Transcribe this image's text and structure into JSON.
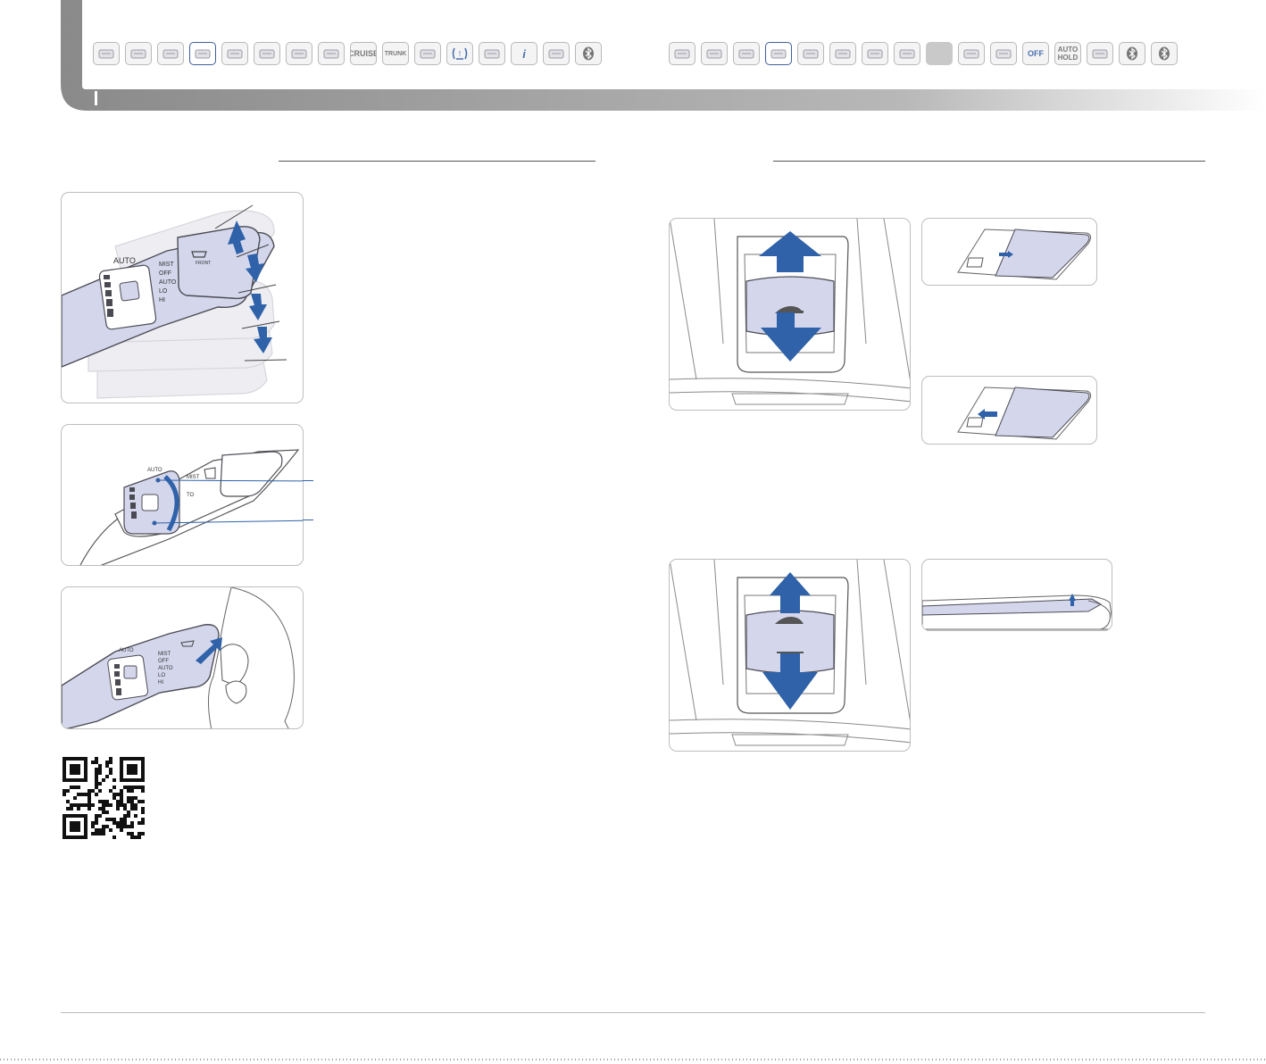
{
  "nav_left": [
    {
      "icon": "wiper-blade-icon"
    },
    {
      "icon": "steering-wheel-icon"
    },
    {
      "icon": "stalk-lever-icon"
    },
    {
      "icon": "wiper-stalk-icon",
      "active": true
    },
    {
      "icon": "seat-icon"
    },
    {
      "icon": "panel-icon"
    },
    {
      "icon": "switch-panel-icon"
    },
    {
      "icon": "mirror-icon"
    },
    {
      "icon": "cruise-icon",
      "label": "CRUISE"
    },
    {
      "icon": "trunk-icon",
      "label": "TRUNK"
    },
    {
      "icon": "key-fob-icon"
    },
    {
      "icon": "tpms-warning-icon"
    },
    {
      "icon": "display-icon"
    },
    {
      "icon": "info-display-icon",
      "label": "i"
    },
    {
      "icon": "climate-panel-icon"
    },
    {
      "icon": "bluetooth-icon"
    }
  ],
  "nav_right": [
    {
      "icon": "voice-icon"
    },
    {
      "icon": "gauge-icon"
    },
    {
      "icon": "key-icon"
    },
    {
      "icon": "sunroof-icon",
      "active": true
    },
    {
      "icon": "console-icon"
    },
    {
      "icon": "switch-bank-icon"
    },
    {
      "icon": "button-cluster-icon"
    },
    {
      "icon": "grid-icon"
    },
    {
      "icon": "blank-icon",
      "dim": true
    },
    {
      "icon": "screen-icon"
    },
    {
      "icon": "gear-shift-icon"
    },
    {
      "icon": "traction-off-icon",
      "label": "OFF"
    },
    {
      "icon": "auto-hold-icon",
      "label_top": "AUTO",
      "label_bottom": "HOLD"
    },
    {
      "icon": "parking-icon"
    },
    {
      "icon": "bluetooth-icon"
    },
    {
      "icon": "bluetooth-icon"
    }
  ],
  "stalk": {
    "labels": [
      "AUTO",
      "MIST",
      "OFF",
      "AUTO",
      "LO",
      "HI"
    ],
    "front_label": "FRONT"
  },
  "colors": {
    "accent_blue": "#2f62a8",
    "panel_lavender": "#d4d6ec",
    "nav_active": "#3f5f9b"
  }
}
